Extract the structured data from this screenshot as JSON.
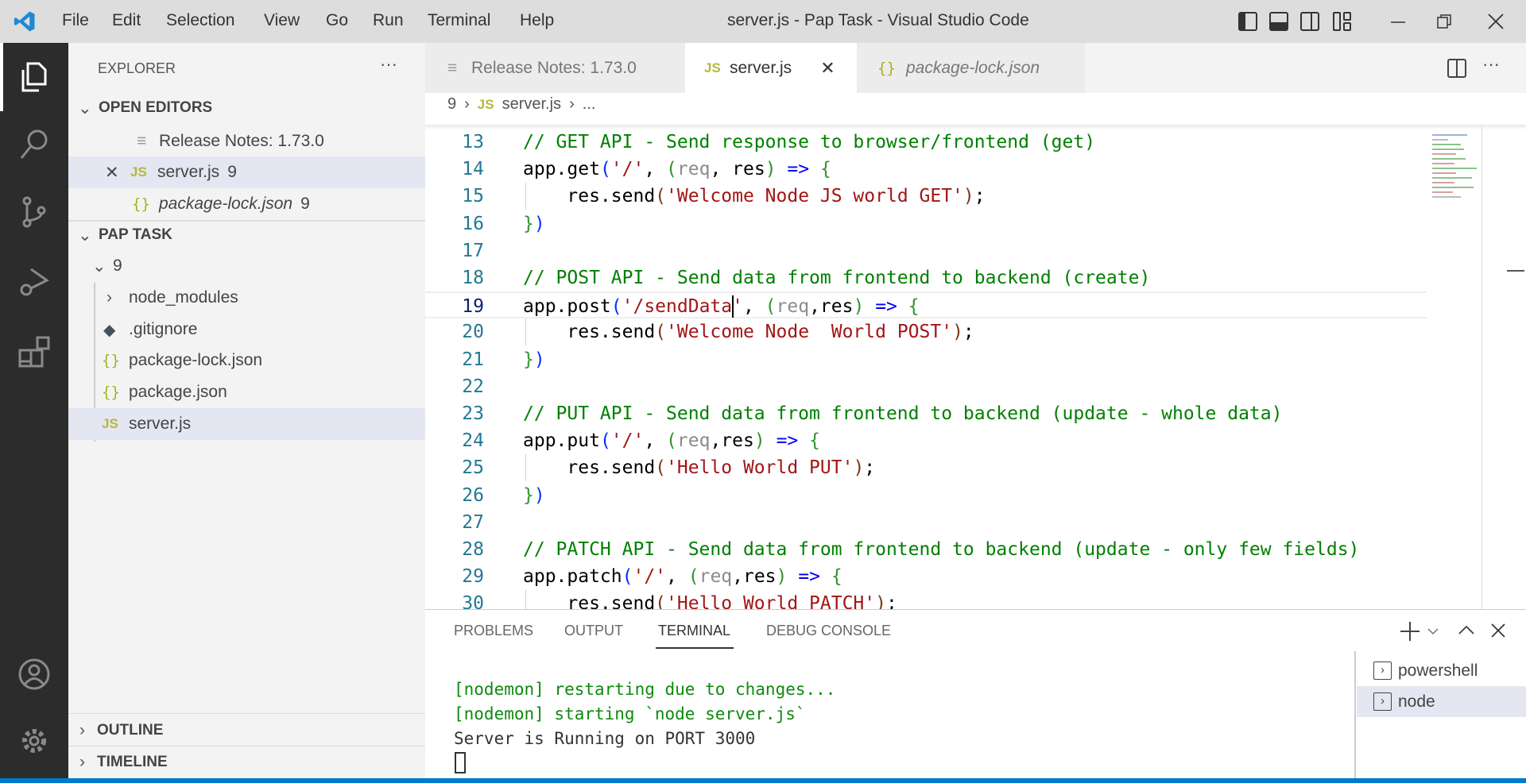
{
  "titlebar": {
    "menu": [
      "File",
      "Edit",
      "Selection",
      "View",
      "Go",
      "Run",
      "Terminal",
      "Help"
    ],
    "title": "server.js - Pap Task - Visual Studio Code"
  },
  "sidebar": {
    "title": "EXPLORER",
    "more": "···",
    "open_editors": {
      "header": "OPEN EDITORS",
      "items": [
        {
          "label": "Release Notes: 1.73.0",
          "badge": ""
        },
        {
          "label": "server.js",
          "badge": "9"
        },
        {
          "label": "package-lock.json",
          "badge": "9"
        }
      ]
    },
    "workspace": {
      "header": "PAP TASK",
      "folder": "9",
      "items": [
        {
          "label": "node_modules",
          "icon": "chevron-right"
        },
        {
          "label": ".gitignore",
          "icon": "git"
        },
        {
          "label": "package-lock.json",
          "icon": "json"
        },
        {
          "label": "package.json",
          "icon": "json"
        },
        {
          "label": "server.js",
          "icon": "js"
        }
      ]
    },
    "outline": "OUTLINE",
    "timeline": "TIMELINE"
  },
  "tabs": [
    {
      "label": "Release Notes: 1.73.0",
      "active": false
    },
    {
      "label": "server.js",
      "active": true
    },
    {
      "label": "package-lock.json",
      "active": false
    }
  ],
  "breadcrumb": {
    "folder": "9",
    "file": "server.js",
    "more": "..."
  },
  "editor": {
    "current_line": 19,
    "lines": [
      {
        "n": 13,
        "t": [
          [
            "// GET API - Send response to browser/frontend (get)",
            "cm"
          ]
        ]
      },
      {
        "n": 14,
        "t": [
          [
            "app.get",
            "pl"
          ],
          [
            "(",
            "p1"
          ],
          [
            "'/'",
            "st"
          ],
          [
            ", ",
            "pl"
          ],
          [
            "(",
            "p2"
          ],
          [
            "req",
            "un"
          ],
          [
            ", res",
            "pl"
          ],
          [
            ")",
            "p2"
          ],
          [
            " ",
            "pl"
          ],
          [
            "=>",
            "kw"
          ],
          [
            " ",
            "pl"
          ],
          [
            "{",
            "p2"
          ]
        ]
      },
      {
        "n": 15,
        "t": [
          [
            "    res.send",
            "pl"
          ],
          [
            "(",
            "p3"
          ],
          [
            "'Welcome Node JS world GET'",
            "st"
          ],
          [
            ")",
            "p3"
          ],
          [
            ";",
            "pl"
          ]
        ]
      },
      {
        "n": 16,
        "t": [
          [
            "}",
            "p2"
          ],
          [
            ")",
            "p1"
          ]
        ]
      },
      {
        "n": 17,
        "t": []
      },
      {
        "n": 18,
        "t": [
          [
            "// POST API - Send data from frontend to backend (create)",
            "cm"
          ]
        ]
      },
      {
        "n": 19,
        "t": [
          [
            "app.post",
            "pl"
          ],
          [
            "(",
            "p1"
          ],
          [
            "'/sendData'",
            "st"
          ],
          [
            ", ",
            "pl"
          ],
          [
            "(",
            "p2"
          ],
          [
            "req",
            "un"
          ],
          [
            ",res",
            "pl"
          ],
          [
            ")",
            "p2"
          ],
          [
            " ",
            "pl"
          ],
          [
            "=>",
            "kw"
          ],
          [
            " ",
            "pl"
          ],
          [
            "{",
            "p2"
          ]
        ]
      },
      {
        "n": 20,
        "t": [
          [
            "    res.send",
            "pl"
          ],
          [
            "(",
            "p3"
          ],
          [
            "'Welcome Node  World POST'",
            "st"
          ],
          [
            ")",
            "p3"
          ],
          [
            ";",
            "pl"
          ]
        ]
      },
      {
        "n": 21,
        "t": [
          [
            "}",
            "p2"
          ],
          [
            ")",
            "p1"
          ]
        ]
      },
      {
        "n": 22,
        "t": []
      },
      {
        "n": 23,
        "t": [
          [
            "// PUT API - Send data from frontend to backend (update - whole data)",
            "cm"
          ]
        ]
      },
      {
        "n": 24,
        "t": [
          [
            "app.put",
            "pl"
          ],
          [
            "(",
            "p1"
          ],
          [
            "'/'",
            "st"
          ],
          [
            ", ",
            "pl"
          ],
          [
            "(",
            "p2"
          ],
          [
            "req",
            "un"
          ],
          [
            ",res",
            "pl"
          ],
          [
            ")",
            "p2"
          ],
          [
            " ",
            "pl"
          ],
          [
            "=>",
            "kw"
          ],
          [
            " ",
            "pl"
          ],
          [
            "{",
            "p2"
          ]
        ]
      },
      {
        "n": 25,
        "t": [
          [
            "    res.send",
            "pl"
          ],
          [
            "(",
            "p3"
          ],
          [
            "'Hello World PUT'",
            "st"
          ],
          [
            ")",
            "p3"
          ],
          [
            ";",
            "pl"
          ]
        ]
      },
      {
        "n": 26,
        "t": [
          [
            "}",
            "p2"
          ],
          [
            ")",
            "p1"
          ]
        ]
      },
      {
        "n": 27,
        "t": []
      },
      {
        "n": 28,
        "t": [
          [
            "// PATCH API - Send data from frontend to backend (update - only few fields)",
            "cm"
          ]
        ]
      },
      {
        "n": 29,
        "t": [
          [
            "app.patch",
            "pl"
          ],
          [
            "(",
            "p1"
          ],
          [
            "'/'",
            "st"
          ],
          [
            ", ",
            "pl"
          ],
          [
            "(",
            "p2"
          ],
          [
            "req",
            "un"
          ],
          [
            ",res",
            "pl"
          ],
          [
            ")",
            "p2"
          ],
          [
            " ",
            "pl"
          ],
          [
            "=>",
            "kw"
          ],
          [
            " ",
            "pl"
          ],
          [
            "{",
            "p2"
          ]
        ]
      },
      {
        "n": 30,
        "t": [
          [
            "    res.send",
            "pl"
          ],
          [
            "(",
            "p3"
          ],
          [
            "'Hello World PATCH'",
            "st"
          ],
          [
            ")",
            "p3"
          ],
          [
            ";",
            "pl"
          ]
        ]
      }
    ]
  },
  "panel": {
    "tabs": [
      "PROBLEMS",
      "OUTPUT",
      "TERMINAL",
      "DEBUG CONSOLE"
    ],
    "active_tab": "TERMINAL",
    "terminal_lines": [
      {
        "text": "[nodemon] restarting due to changes...",
        "color": "#0e8a0e"
      },
      {
        "text": "[nodemon] starting `node server.js`",
        "color": "#0e8a0e"
      },
      {
        "text": "Server is Running on PORT 3000",
        "color": "#333333"
      }
    ],
    "terminals": [
      "powershell",
      "node"
    ],
    "active_terminal": "node"
  },
  "colors": {
    "accent": "#007acc",
    "activity_bar": "#2c2c2c",
    "sidebar": "#f3f3f3",
    "selection": "#e4e6f1"
  }
}
